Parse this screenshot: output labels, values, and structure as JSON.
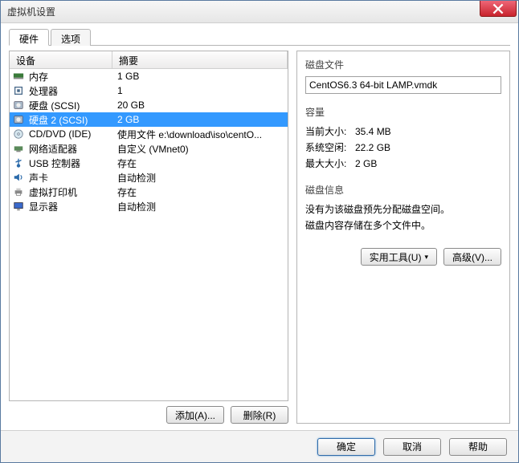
{
  "title": "虚拟机设置",
  "tabs": {
    "hardware": "硬件",
    "options": "选项"
  },
  "headers": {
    "device": "设备",
    "summary": "摘要"
  },
  "devices": [
    {
      "icon": "memory",
      "name": "内存",
      "summary": "1 GB",
      "selected": false
    },
    {
      "icon": "cpu",
      "name": "处理器",
      "summary": "1",
      "selected": false
    },
    {
      "icon": "disk",
      "name": "硬盘 (SCSI)",
      "summary": "20 GB",
      "selected": false
    },
    {
      "icon": "disk",
      "name": "硬盘 2 (SCSI)",
      "summary": "2 GB",
      "selected": true
    },
    {
      "icon": "cd",
      "name": "CD/DVD (IDE)",
      "summary": "使用文件 e:\\download\\iso\\centO...",
      "selected": false
    },
    {
      "icon": "net",
      "name": "网络适配器",
      "summary": "自定义 (VMnet0)",
      "selected": false
    },
    {
      "icon": "usb",
      "name": "USB 控制器",
      "summary": "存在",
      "selected": false
    },
    {
      "icon": "sound",
      "name": "声卡",
      "summary": "自动检测",
      "selected": false
    },
    {
      "icon": "printer",
      "name": "虚拟打印机",
      "summary": "存在",
      "selected": false
    },
    {
      "icon": "display",
      "name": "显示器",
      "summary": "自动检测",
      "selected": false
    }
  ],
  "leftButtons": {
    "add": "添加(A)...",
    "remove": "删除(R)"
  },
  "right": {
    "diskFile": {
      "label": "磁盘文件",
      "value": "CentOS6.3 64-bit LAMP.vmdk"
    },
    "capacity": {
      "label": "容量",
      "current": {
        "k": "当前大小:",
        "v": "35.4 MB"
      },
      "free": {
        "k": "系统空闲:",
        "v": "22.2 GB"
      },
      "max": {
        "k": "最大大小:",
        "v": "2 GB"
      }
    },
    "info": {
      "label": "磁盘信息",
      "line1": "没有为该磁盘预先分配磁盘空间。",
      "line2": "磁盘内容存储在多个文件中。"
    },
    "buttons": {
      "util": "实用工具(U)",
      "adv": "高级(V)..."
    }
  },
  "footer": {
    "ok": "确定",
    "cancel": "取消",
    "help": "帮助"
  }
}
